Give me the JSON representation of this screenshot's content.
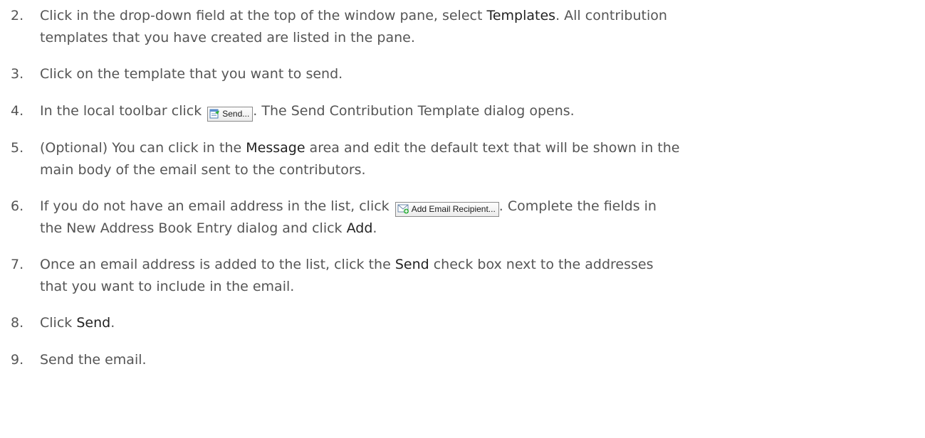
{
  "steps": [
    {
      "number": "2.",
      "line1_a": "Click in the drop-down field at the top of the window pane, select ",
      "line1_bold": "Templates",
      "line1_b": ". All contribution",
      "line2": "templates that you have created are listed in the pane."
    },
    {
      "number": "3.",
      "text": "Click on the template that you want to send."
    },
    {
      "number": "4.",
      "text_a": "In the local toolbar click ",
      "button_label": "Send...",
      "button_icon": "send-template-icon",
      "text_b": ". The Send Contribution Template dialog opens."
    },
    {
      "number": "5.",
      "line1_a": "(Optional) You can click in the ",
      "line1_bold": "Message",
      "line1_b": " area and edit the default text that will be shown in the",
      "line2": "main body of the email sent to the contributors."
    },
    {
      "number": "6.",
      "line1_a": "If you do not have an email address in the list, click ",
      "button_label": "Add Email Recipient...",
      "button_icon": "add-email-recipient-icon",
      "line1_b": ". Complete the fields in",
      "line2_a": "the New Address Book Entry dialog and click ",
      "line2_bold": "Add",
      "line2_b": "."
    },
    {
      "number": "7.",
      "line1_a": "Once an email address is added to the list, click the ",
      "line1_bold": "Send",
      "line1_b": " check box next to the addresses",
      "line2": "that you want to include in the email."
    },
    {
      "number": "8.",
      "text_a": "Click ",
      "text_bold": "Send",
      "text_b": "."
    },
    {
      "number": "9.",
      "text": "Send the email."
    }
  ],
  "colors": {
    "body_text": "#555555",
    "bold_text": "#222222",
    "button_border": "#8a8a8a"
  }
}
